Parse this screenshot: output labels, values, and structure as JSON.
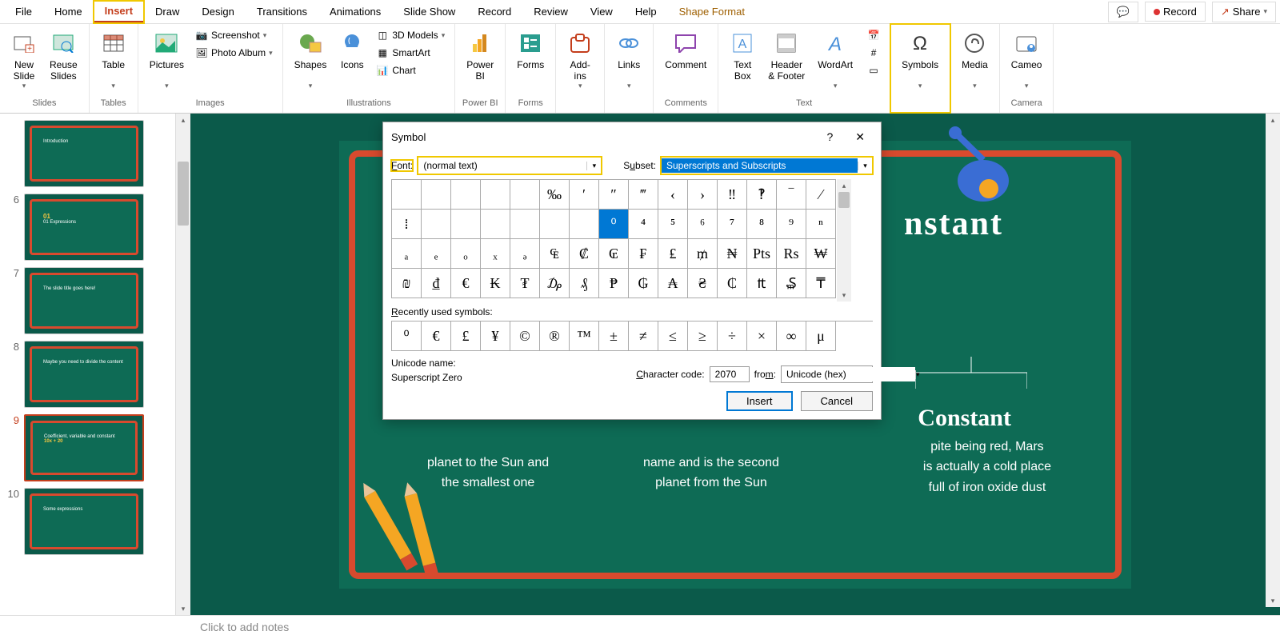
{
  "menu": {
    "items": [
      "File",
      "Home",
      "Insert",
      "Draw",
      "Design",
      "Transitions",
      "Animations",
      "Slide Show",
      "Record",
      "Review",
      "View",
      "Help",
      "Shape Format"
    ],
    "active_index": 2,
    "comment_icon": "comment",
    "record": "Record",
    "share": "Share"
  },
  "ribbon": {
    "groups": [
      {
        "label": "Slides",
        "items": [
          {
            "label": "New\nSlide",
            "dropdown": true
          },
          {
            "label": "Reuse\nSlides"
          }
        ]
      },
      {
        "label": "Tables",
        "items": [
          {
            "label": "Table",
            "dropdown": true
          }
        ]
      },
      {
        "label": "Images",
        "items": [
          {
            "label": "Pictures",
            "dropdown": true
          }
        ],
        "small": [
          {
            "label": "Screenshot",
            "dropdown": true
          },
          {
            "label": "Photo Album",
            "dropdown": true
          }
        ]
      },
      {
        "label": "Illustrations",
        "items": [
          {
            "label": "Shapes",
            "dropdown": true
          },
          {
            "label": "Icons"
          }
        ],
        "small": [
          {
            "label": "3D Models",
            "dropdown": true
          },
          {
            "label": "SmartArt"
          },
          {
            "label": "Chart"
          }
        ]
      },
      {
        "label": "Power BI",
        "items": [
          {
            "label": "Power\nBI"
          }
        ]
      },
      {
        "label": "Forms",
        "items": [
          {
            "label": "Forms"
          }
        ]
      },
      {
        "label": "",
        "items": [
          {
            "label": "Add-\nins",
            "dropdown": true
          }
        ]
      },
      {
        "label": "",
        "items": [
          {
            "label": "Links",
            "dropdown": true
          }
        ]
      },
      {
        "label": "Comments",
        "items": [
          {
            "label": "Comment"
          }
        ]
      },
      {
        "label": "Text",
        "items": [
          {
            "label": "Text\nBox"
          },
          {
            "label": "Header\n& Footer"
          },
          {
            "label": "WordArt",
            "dropdown": true
          }
        ]
      },
      {
        "label": "",
        "items": [
          {
            "label": "Symbols",
            "dropdown": true
          }
        ],
        "highlight": true
      },
      {
        "label": "",
        "items": [
          {
            "label": "Media",
            "dropdown": true
          }
        ]
      },
      {
        "label": "Camera",
        "items": [
          {
            "label": "Cameo",
            "dropdown": true
          }
        ]
      }
    ]
  },
  "thumbs": [
    {
      "num": "",
      "title": "Introduction"
    },
    {
      "num": "6",
      "title": "01 Expressions"
    },
    {
      "num": "7",
      "title": "The slide title goes here!"
    },
    {
      "num": "8",
      "title": "Maybe you need to divide the content"
    },
    {
      "num": "9",
      "title": "Coefficient, variable and constant",
      "selected": true,
      "subtitle": "10x + 20"
    },
    {
      "num": "10",
      "title": "Some expressions"
    }
  ],
  "slide": {
    "title_right": "nstant",
    "heading": "Constant",
    "body1": "pite being red, Mars",
    "body2": "is actually a cold place",
    "body3": "full of iron oxide dust",
    "left1": "planet to the Sun and",
    "left2": "the smallest one",
    "mid1": "name and is the second",
    "mid2": "planet from the Sun"
  },
  "dialog": {
    "title": "Symbol",
    "font_label": "Font:",
    "font_value": "(normal text)",
    "subset_label": "Subset:",
    "subset_value": "Superscripts and Subscripts",
    "grid": [
      [
        "",
        "",
        "",
        "",
        "",
        "‰",
        "′",
        "″",
        "‴",
        "‹",
        "›",
        "‼",
        "‽",
        "‾",
        "⁄"
      ],
      [
        "⁞",
        "",
        "",
        "",
        "",
        "",
        "",
        "⁰",
        "⁴",
        "⁵",
        "⁶",
        "⁷",
        "⁸",
        "⁹",
        "ⁿ"
      ],
      [
        "ₐ",
        "ₑ",
        "ₒ",
        "ₓ",
        "ₔ",
        "₠",
        "₡",
        "₢",
        "₣",
        "₤",
        "₥",
        "₦",
        "Pts",
        "Rs",
        "₩"
      ],
      [
        "₪",
        "₫",
        "€",
        "₭",
        "₮",
        "₯",
        "₰",
        "₱",
        "₲",
        "₳",
        "₴",
        "₵",
        "₶",
        "₷",
        "₸"
      ]
    ],
    "selected_row": 1,
    "selected_col": 7,
    "recent_label": "Recently used symbols:",
    "recent": [
      "⁰",
      "€",
      "£",
      "¥",
      "©",
      "®",
      "™",
      "±",
      "≠",
      "≤",
      "≥",
      "÷",
      "×",
      "∞",
      "μ"
    ],
    "unicode_name_label": "Unicode name:",
    "unicode_name": "Superscript Zero",
    "char_code_label": "Character code:",
    "char_code": "2070",
    "from_label": "from:",
    "from_value": "Unicode (hex)",
    "insert": "Insert",
    "cancel": "Cancel"
  },
  "notes": {
    "placeholder": "Click to add notes"
  }
}
